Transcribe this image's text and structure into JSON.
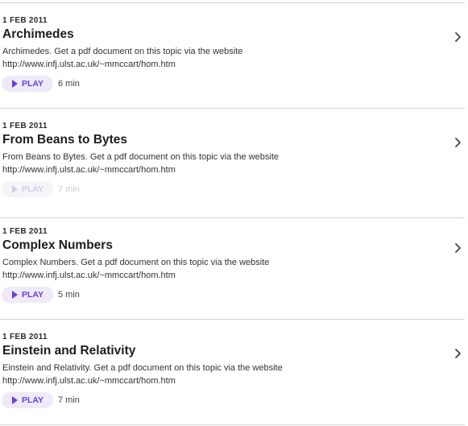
{
  "episodes": [
    {
      "date": "1 FEB 2011",
      "title": "Archimedes",
      "description_line1": "Archimedes. Get a pdf document on this topic via the website",
      "description_line2": "http://www.infj.ulst.ac.uk/~mmccart/hom.htm",
      "play_label": "PLAY",
      "duration": "6 min",
      "playable": true
    },
    {
      "date": "1 FEB 2011",
      "title": "From Beans to Bytes",
      "description_line1": "From Beans to Bytes. Get a pdf document on this topic via the website",
      "description_line2": "http://www.infj.ulst.ac.uk/~mmccart/hom.htm",
      "play_label": "PLAY",
      "duration": "7 min",
      "playable": false
    },
    {
      "date": "1 FEB 2011",
      "title": "Complex Numbers",
      "description_line1": "Complex Numbers. Get a pdf document on this topic via the website",
      "description_line2": "http://www.infj.ulst.ac.uk/~mmccart/hom.htm",
      "play_label": "PLAY",
      "duration": "5 min",
      "playable": true
    },
    {
      "date": "1 FEB 2011",
      "title": "Einstein and Relativity",
      "description_line1": "Einstein and Relativity. Get a pdf document on this topic via the website",
      "description_line2": "http://www.infj.ulst.ac.uk/~mmccart/hom.htm",
      "play_label": "PLAY",
      "duration": "7 min",
      "playable": true
    }
  ],
  "colors": {
    "accent": "#6a3fd9",
    "play_bg": "#efeafa",
    "divider": "#d6d6d6"
  },
  "icons": {
    "play": "play-triangle-icon",
    "chevron": "chevron-right-icon"
  }
}
